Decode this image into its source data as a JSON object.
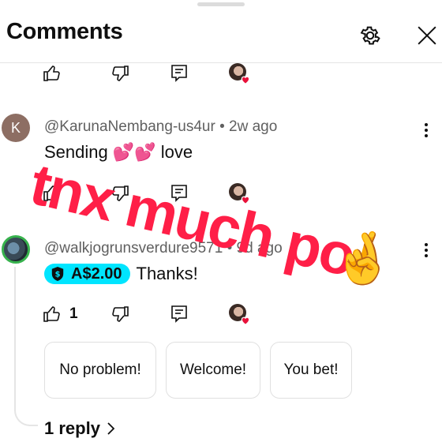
{
  "header": {
    "title": "Comments"
  },
  "top_actions": {
    "icons": [
      "thumbs-up-icon",
      "thumbs-down-icon",
      "reply-icon",
      "creator-heart-icon"
    ]
  },
  "comments": [
    {
      "avatar_letter": "K",
      "handle": "@KarunaNembang-us4ur",
      "separator": "•",
      "time": "2w ago",
      "text": "Sending 💕💕 love"
    },
    {
      "handle": "@walkjogrunsverdure9571",
      "separator": "•",
      "time": "9d ago",
      "super_thanks_amount": "A$2.00",
      "text": "Thanks!",
      "like_count": "1",
      "quick_replies": [
        "No problem!",
        "Welcome!",
        "You bet!"
      ],
      "replies_label": "1 reply"
    }
  ],
  "overlay": {
    "text": "tnx much po",
    "emoji": "🤞"
  },
  "colors": {
    "super_thanks": "#00e5ff",
    "overlay_text": "#ff1f47",
    "heart": "#e8113a",
    "avatar_k": "#8d6e63"
  }
}
